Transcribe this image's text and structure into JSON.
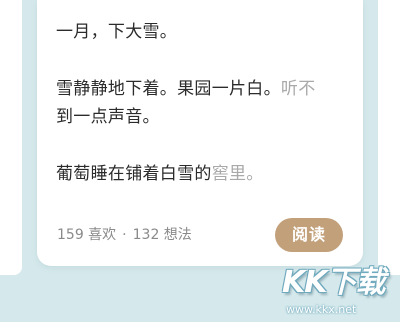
{
  "post": {
    "line1": "一月，下大雪。",
    "line2_dark": "雪静静地下着。果园一片白。",
    "line2_fade": "听不",
    "line3": "到一点声音。",
    "line4_dark": "葡萄睡在铺着白雪的",
    "line4_fade": "窖里。"
  },
  "footer": {
    "likes": "159 喜欢",
    "separator": "·",
    "thoughts": "132 想法",
    "read_button": "阅读"
  },
  "watermark": {
    "logo": "KK下载",
    "url": "www.kkx.net"
  },
  "colors": {
    "background": "#d5e9ec",
    "text_dark": "#2b2b2b",
    "text_fade": "#a9a9a9",
    "button": "#c2a07a"
  }
}
